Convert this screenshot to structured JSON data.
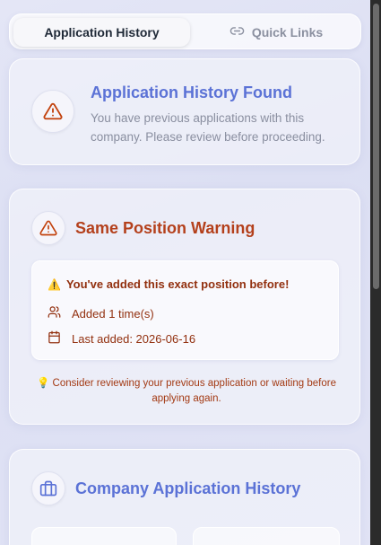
{
  "tabs": {
    "history_label": "Application History",
    "links_label": "Quick Links"
  },
  "found_card": {
    "title": "Application History Found",
    "text": "You have previous applications with this company. Please review before proceeding."
  },
  "warning_card": {
    "title": "Same Position Warning",
    "alert_emoji": "⚠️",
    "alert_text": "You've added this exact position before!",
    "added_count": "Added 1 time(s)",
    "last_added": "Last added: 2026-06-16",
    "tip_emoji": "💡",
    "tip_text": "Consider reviewing your previous application or waiting before applying again."
  },
  "company_card": {
    "title": "Company Application History"
  },
  "colors": {
    "accent_blue": "#5b72d6",
    "warning_red": "#b4401c",
    "warning_dark": "#92300f"
  },
  "icons": [
    "link-icon",
    "alert-triangle-icon",
    "users-icon",
    "calendar-icon",
    "briefcase-icon",
    "lightbulb-icon"
  ]
}
